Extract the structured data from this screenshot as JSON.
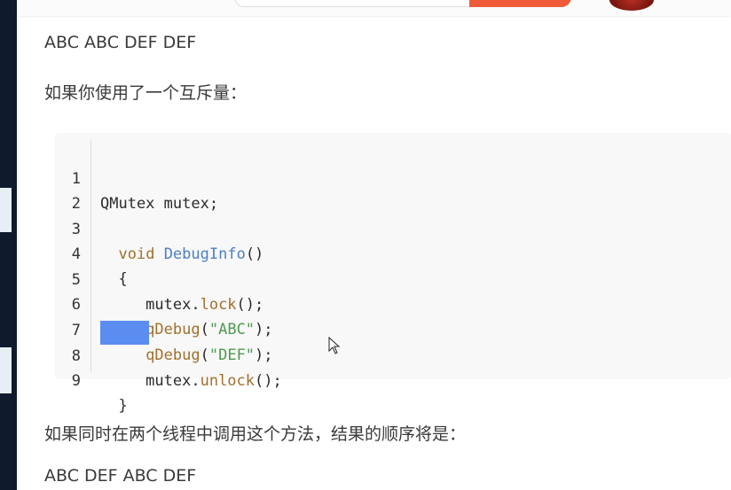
{
  "paragraphs": {
    "p1": "ABC ABC DEF DEF",
    "p2": "如果你使用了一个互斥量：",
    "p3": "如果同时在两个线程中调用这个方法，结果的顺序将是：",
    "p4": "ABC DEF ABC DEF"
  },
  "code": {
    "language": "cpp",
    "lines": [
      {
        "n": "1",
        "text": "QMutex mutex;"
      },
      {
        "n": "2",
        "text": ""
      },
      {
        "n": "3",
        "text": "  void DebugInfo()"
      },
      {
        "n": "4",
        "text": "  {"
      },
      {
        "n": "5",
        "text": "     mutex.lock();"
      },
      {
        "n": "6",
        "text": "     qDebug(\"ABC\");"
      },
      {
        "n": "7",
        "text": "     qDebug(\"DEF\");"
      },
      {
        "n": "8",
        "text": "     mutex.unlock();"
      },
      {
        "n": "9",
        "text": "  }"
      }
    ]
  },
  "colors": {
    "keyword": "#a26f2c",
    "function": "#4a7fc4",
    "string": "#4f9a4f",
    "selection": "#5b8cf0",
    "search_button": "#ef5b38"
  },
  "icons": {
    "cursor": "arrow-cursor-icon"
  }
}
